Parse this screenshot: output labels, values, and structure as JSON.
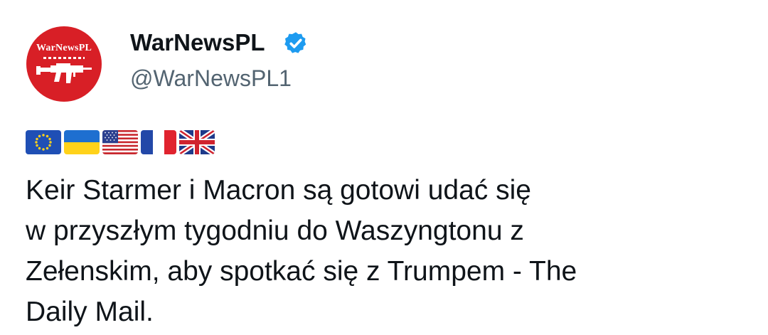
{
  "tweet": {
    "author": {
      "display_name": "WarNewsPL",
      "handle": "@WarNewsPL1",
      "verified": true,
      "verified_badge_color": "#1d9bf0",
      "avatar": {
        "logo_text": "WarNewsPL",
        "background_color": "#d81f26",
        "icon": "rifle-logo-icon"
      }
    },
    "flags": [
      {
        "name": "eu-flag-icon"
      },
      {
        "name": "ukraine-flag-icon"
      },
      {
        "name": "usa-flag-icon"
      },
      {
        "name": "france-flag-icon"
      },
      {
        "name": "uk-flag-icon"
      }
    ],
    "text": "Keir Starmer i Macron są gotowi udać się\nw przyszłym tygodniu do Waszyngtonu z\nZełenskim, aby spotkać się z Trumpem -  The\nDaily Mail."
  }
}
